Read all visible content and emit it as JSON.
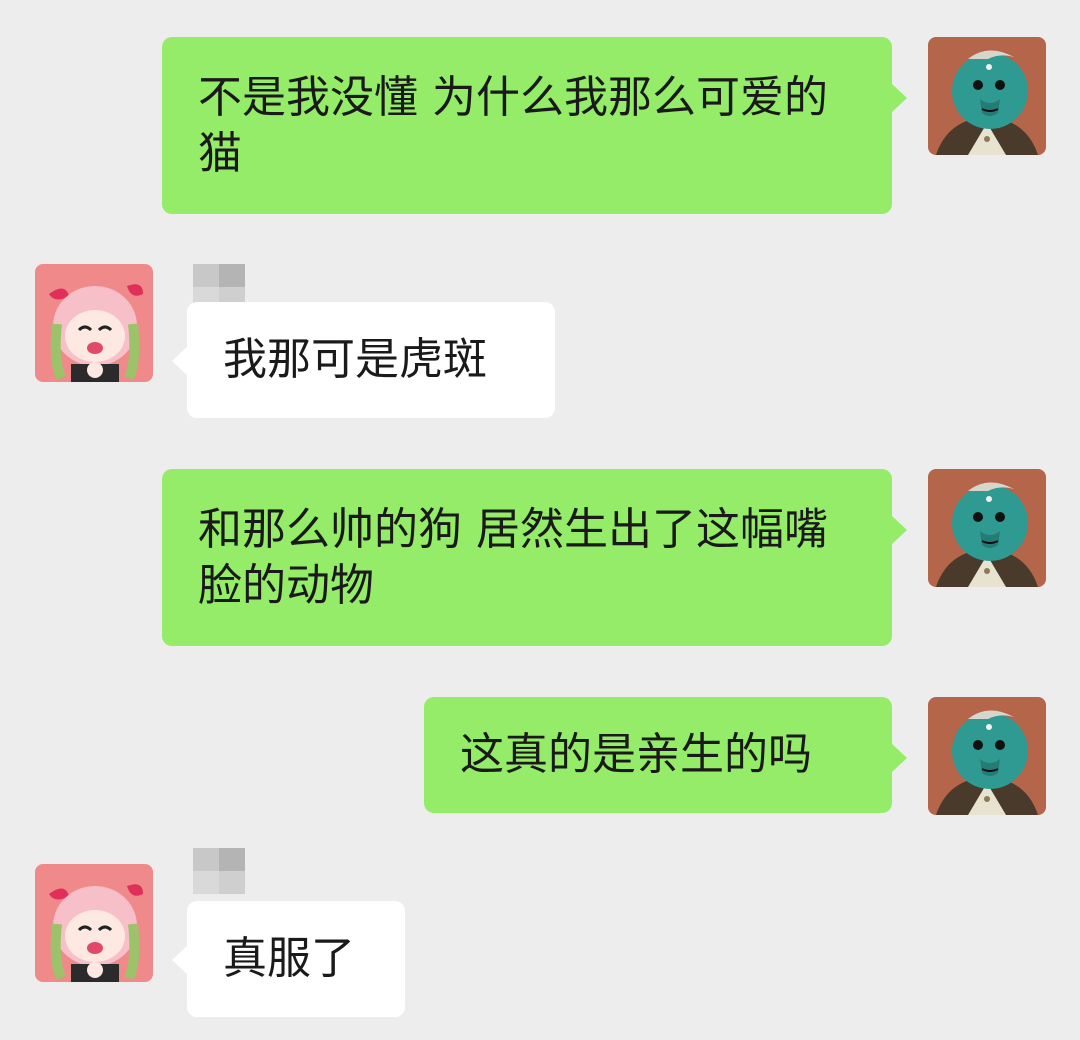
{
  "colors": {
    "background": "#ededed",
    "sent_bubble": "#95ec69",
    "received_bubble": "#ffffff"
  },
  "me": {
    "avatar_icon": "green-cartoon-man-avatar-icon"
  },
  "friend": {
    "avatar_icon": "pink-anime-girl-avatar-icon",
    "name_mosaic": "pixelated-name-icon"
  },
  "messages": [
    {
      "from": "me",
      "text": "不是我没懂 为什么我那么可爱的猫"
    },
    {
      "from": "friend",
      "text": "我那可是虎斑"
    },
    {
      "from": "me",
      "text": "和那么帅的狗 居然生出了这幅嘴脸的动物"
    },
    {
      "from": "me",
      "text": "这真的是亲生的吗"
    },
    {
      "from": "friend",
      "text": "真服了"
    }
  ]
}
